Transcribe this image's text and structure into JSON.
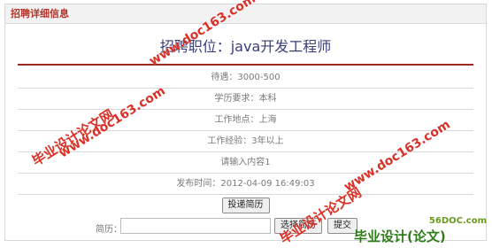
{
  "panel": {
    "header": "招聘详细信息"
  },
  "job": {
    "title": "招聘职位：java开发工程师"
  },
  "details": [
    "待遇：3000-500",
    "学历要求：本科",
    "工作地点：上海",
    "工作经验：3年以上",
    "请输入内容1",
    "发布时间：2012-04-09 16:49:03"
  ],
  "actions": {
    "apply_label": "投递简历",
    "resume_label": "简历：",
    "choose_label": "选择简历",
    "submit_label": "提交"
  },
  "watermarks": {
    "url": "www.doc163.com",
    "cn": "毕业设计论文网"
  },
  "corner": {
    "site": "56DOC.com",
    "brand": "毕业设计(论文)"
  },
  "colors": {
    "accent": "#9b2a22",
    "title": "#3a3f7a",
    "watermark": "#d9261c"
  }
}
